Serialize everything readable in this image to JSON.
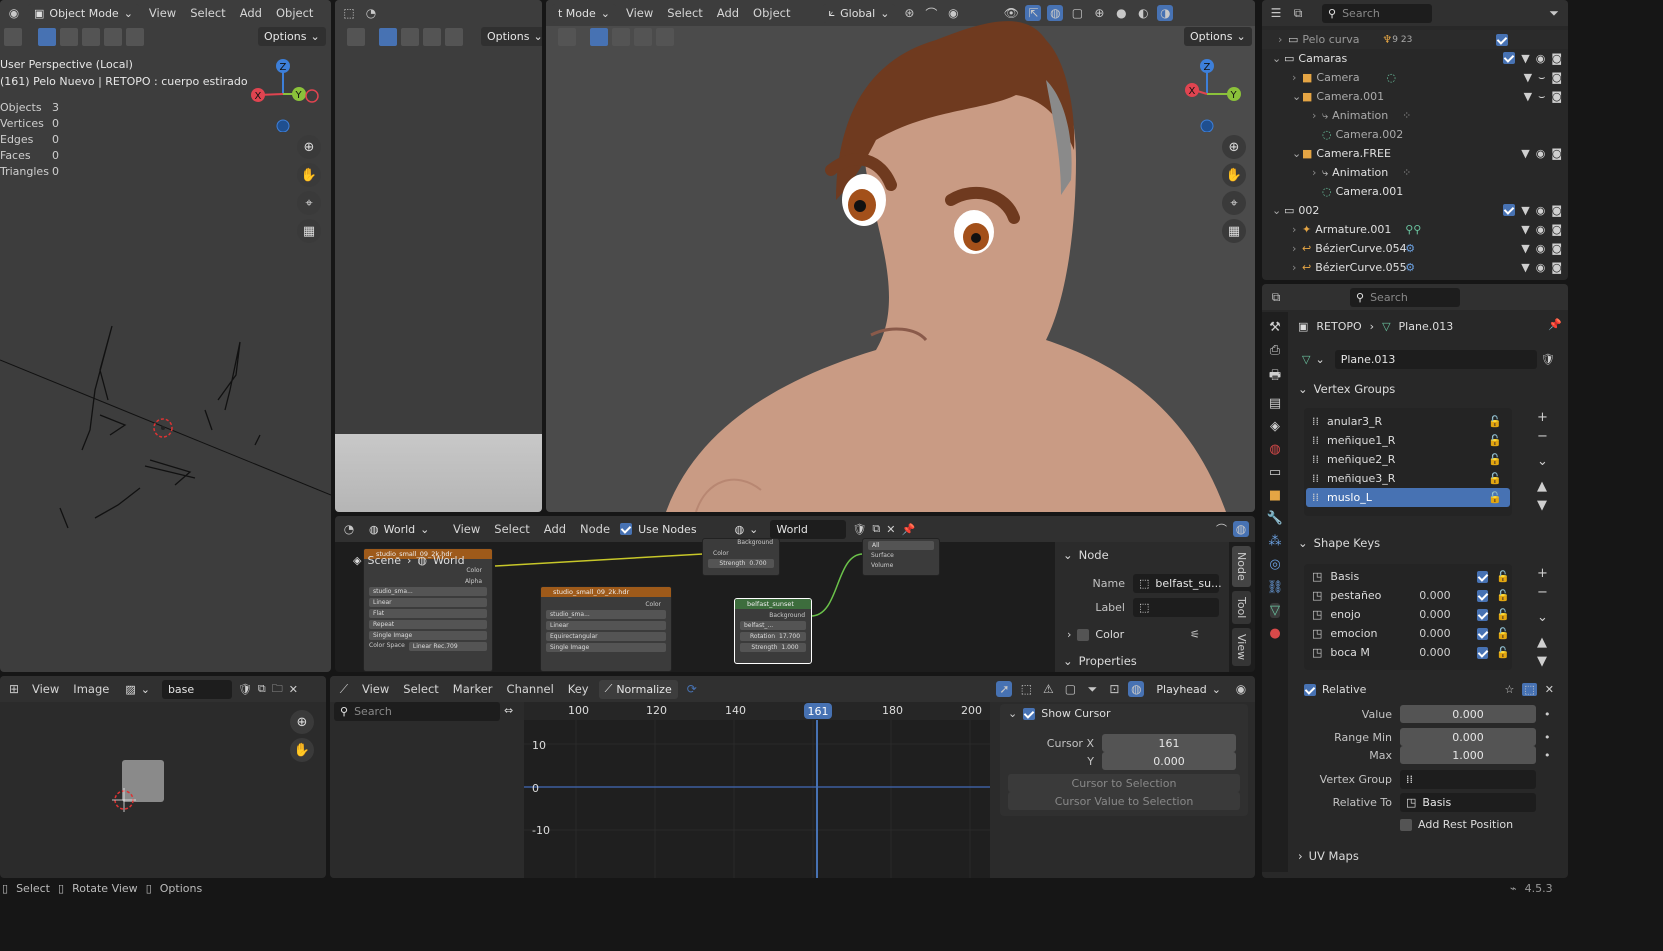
{
  "viewport_left": {
    "mode": "Object Mode",
    "menus": [
      "View",
      "Select",
      "Add",
      "Object"
    ],
    "options": "Options",
    "perspective": "User Perspective (Local)",
    "object_info": "(161) Pelo Nuevo | RETOPO : cuerpo estirado",
    "stats": [
      {
        "label": "Objects",
        "value": "3"
      },
      {
        "label": "Vertices",
        "value": "0"
      },
      {
        "label": "Edges",
        "value": "0"
      },
      {
        "label": "Faces",
        "value": "0"
      },
      {
        "label": "Triangles",
        "value": "0"
      }
    ]
  },
  "viewport_mid": {
    "options": "Options"
  },
  "viewport_main": {
    "mode": "t Mode",
    "menus": [
      "View",
      "Select",
      "Add",
      "Object"
    ],
    "orientation": "Global",
    "options": "Options"
  },
  "gizmo": {
    "x": "X",
    "y": "Y",
    "z": "Z"
  },
  "outliner": {
    "search_placeholder": "Search",
    "rows": [
      {
        "name": "Pelo curva",
        "extra": "9 23"
      },
      {
        "name": "Camaras"
      },
      {
        "name": "Camera"
      },
      {
        "name": "Camera.001"
      },
      {
        "name": "Animation"
      },
      {
        "name": "Camera.002"
      },
      {
        "name": "Camera.FREE"
      },
      {
        "name": "Animation"
      },
      {
        "name": "Camera.001"
      },
      {
        "name": "002"
      },
      {
        "name": "Armature.001"
      },
      {
        "name": "BézierCurve.054"
      },
      {
        "name": "BézierCurve.055"
      }
    ]
  },
  "properties": {
    "search_placeholder": "Search",
    "breadcrumb": [
      "RETOPO",
      "Plane.013"
    ],
    "mesh_name": "Plane.013",
    "vertex_groups_title": "Vertex Groups",
    "vertex_groups": [
      "anular3_R",
      "meñique1_R",
      "meñique2_R",
      "meñique3_R",
      "muslo_L"
    ],
    "shape_keys_title": "Shape Keys",
    "shape_keys": [
      {
        "name": "Basis",
        "value": ""
      },
      {
        "name": "pestañeo",
        "value": "0.000"
      },
      {
        "name": "enojo",
        "value": "0.000"
      },
      {
        "name": "emocion",
        "value": "0.000"
      },
      {
        "name": "boca M",
        "value": "0.000"
      }
    ],
    "relative": "Relative",
    "value_label": "Value",
    "value": "0.000",
    "range_min_label": "Range Min",
    "range_min": "0.000",
    "max_label": "Max",
    "max": "1.000",
    "vertex_group_label": "Vertex Group",
    "relative_to_label": "Relative To",
    "relative_to": "Basis",
    "add_rest_position": "Add Rest Position",
    "uv_maps": "UV Maps"
  },
  "node_editor": {
    "world_type": "World",
    "menus": [
      "View",
      "Select",
      "Add",
      "Node"
    ],
    "use_nodes": "Use Nodes",
    "world_name": "World",
    "breadcrumb": [
      "Scene",
      "World"
    ],
    "node_panel": {
      "title": "Node",
      "name_label": "Name",
      "name_value": "belfast_su...",
      "label_label": "Label",
      "color": "Color",
      "properties": "Properties"
    },
    "tabs": [
      "Node",
      "Tool",
      "View"
    ],
    "nodes": {
      "env1_title": "studio_small_09_2k.hdr",
      "env1_img": "studio_sma...",
      "env1_opts": [
        "Linear",
        "Flat",
        "Repeat",
        "Single Image"
      ],
      "env1_cs_label": "Color Space",
      "env1_cs": "Linear Rec.709",
      "out_color": "Color",
      "out_alpha": "Alpha",
      "env2_title": "studio_small_09_2k.hdr",
      "env2_color": "Color",
      "env2_img": "studio_sma...",
      "env2_opts": [
        "Linear",
        "Equirectangular",
        "Single Image"
      ],
      "bg_title": "Background",
      "bg_color": "Color",
      "bg_strength": "Strength",
      "bg_strength_val": "0.700",
      "out_all": "All",
      "out_surface": "Surface",
      "out_volume": "Volume",
      "sunset_title": "belfast_sunset",
      "sunset_bg": "Background",
      "sunset_img": "belfast_...",
      "sunset_rot": "Rotation",
      "sunset_rot_val": "17.700",
      "sunset_str": "Strength",
      "sunset_str_val": "1.000"
    }
  },
  "image_editor": {
    "menus": [
      "View",
      "Image"
    ],
    "image_name": "base"
  },
  "graph_editor": {
    "menus": [
      "View",
      "Select",
      "Marker",
      "Channel",
      "Key"
    ],
    "normalize": "Normalize",
    "playhead": "Playhead",
    "search_placeholder": "Search",
    "frames": [
      "100",
      "120",
      "140",
      "160",
      "180",
      "200"
    ],
    "current_frame": "161",
    "y_ticks": [
      "10",
      "0",
      "-10"
    ],
    "show_cursor": "Show Cursor",
    "cursor_x_label": "Cursor X",
    "cursor_x": "161",
    "cursor_y_label": "Y",
    "cursor_y": "0.000",
    "cursor_to_selection": "Cursor to Selection",
    "cursor_value_to_selection": "Cursor Value to Selection"
  },
  "statusbar": {
    "items": [
      "Select",
      "Rotate View",
      "Options"
    ],
    "version": "4.5.3"
  },
  "colors": {
    "accent": "#4772b3",
    "bg": "#2b2b2b",
    "header": "#303030",
    "axis_x": "#e04450",
    "axis_y": "#8bc23a",
    "axis_z": "#3d7fd9"
  }
}
